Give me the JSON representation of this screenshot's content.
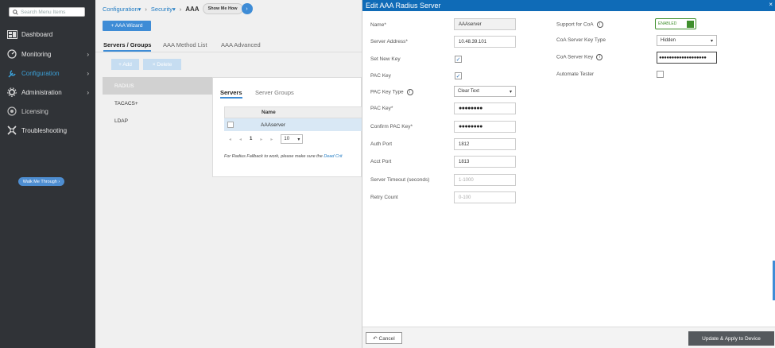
{
  "sidebar": {
    "search_placeholder": "Search Menu Items",
    "items": [
      {
        "label": "Dashboard",
        "icon": "dashboard-icon",
        "chevron": false
      },
      {
        "label": "Monitoring",
        "icon": "monitoring-icon",
        "chevron": true
      },
      {
        "label": "Configuration",
        "icon": "configuration-icon",
        "chevron": true,
        "active": true
      },
      {
        "label": "Administration",
        "icon": "administration-icon",
        "chevron": true
      },
      {
        "label": "Licensing",
        "icon": "licensing-icon",
        "chevron": false
      },
      {
        "label": "Troubleshooting",
        "icon": "troubleshooting-icon",
        "chevron": false
      }
    ],
    "walk_me": "Walk Me Through ›"
  },
  "breadcrumb": {
    "c1": "Configuration",
    "c2": "Security",
    "current": "AAA",
    "show_me_how": "Show Me How"
  },
  "main": {
    "wizard": "+ AAA Wizard",
    "tabs": [
      "Servers / Groups",
      "AAA Method List",
      "AAA Advanced"
    ],
    "add": "+ Add",
    "delete": "× Delete",
    "left_list": [
      "RADIUS",
      "TACACS+",
      "LDAP"
    ],
    "panel_tabs": [
      "Servers",
      "Server Groups"
    ],
    "table_header": "Name",
    "table_row": "AAAserver",
    "pager": {
      "first": "◂",
      "prev": "◂",
      "page": "1",
      "next": "▸",
      "last": "▸",
      "per_page": "10"
    },
    "note": "For Radius Fallback to work, please make sure the",
    "note_link": "Dead Crit"
  },
  "modal": {
    "title": "Edit AAA Radius Server",
    "close": "×",
    "left": {
      "name_label": "Name*",
      "name_value": "AAAserver",
      "address_label": "Server Address*",
      "address_value": "10.48.39.101",
      "setnewkey_label": "Set New Key",
      "packey_label": "PAC Key",
      "packeytype_label": "PAC Key Type",
      "packeytype_value": "Clear Text",
      "packey2_label": "PAC Key*",
      "packey2_value": "●●●●●●●●",
      "confirm_label": "Confirm PAC Key*",
      "confirm_value": "●●●●●●●●",
      "authport_label": "Auth Port",
      "authport_value": "1812",
      "acctport_label": "Acct Port",
      "acctport_value": "1813",
      "timeout_label": "Server Timeout (seconds)",
      "timeout_placeholder": "1-1000",
      "retry_label": "Retry Count",
      "retry_placeholder": "0-100"
    },
    "right": {
      "coa_label": "Support for CoA",
      "coa_value": "ENABLED",
      "coakeytype_label": "CoA Server Key Type",
      "coakeytype_value": "Hidden",
      "coakey_label": "CoA Server Key",
      "coakey_value": "●●●●●●●●●●●●●●●●●●●",
      "automate_label": "Automate Tester"
    },
    "cancel": "↶ Cancel",
    "update": "Update & Apply to Device"
  }
}
